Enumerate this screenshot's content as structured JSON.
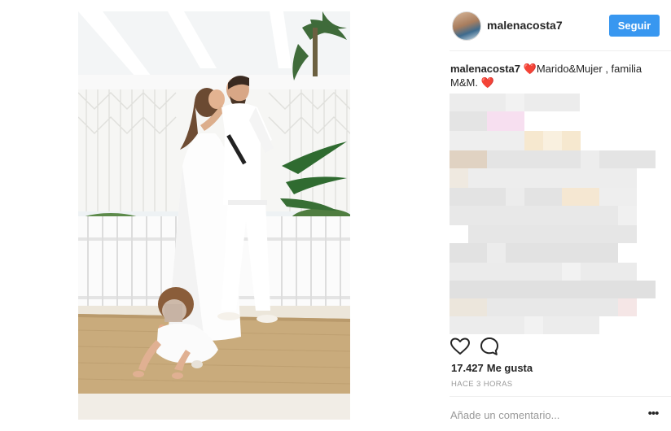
{
  "post": {
    "username": "malenacosta7",
    "follow_label": "Seguir",
    "caption": {
      "username": "malenacosta7",
      "heart": "❤️",
      "text": "Marido&Mujer , familia M&M. ",
      "heart_end": "❤️"
    },
    "likes_count": "17.427",
    "likes_label": "Me gusta",
    "timestamp": "HACE 3 HORAS",
    "comment_placeholder": "Añade un comentario...",
    "more_label": "•••"
  },
  "icons": {
    "like": "heart-outline-icon",
    "comment": "speech-bubble-icon",
    "more": "ellipsis-icon"
  },
  "colors": {
    "accent": "#3897f0",
    "heart": "#ed1c3a",
    "muted_text": "#999999",
    "text": "#262626"
  }
}
